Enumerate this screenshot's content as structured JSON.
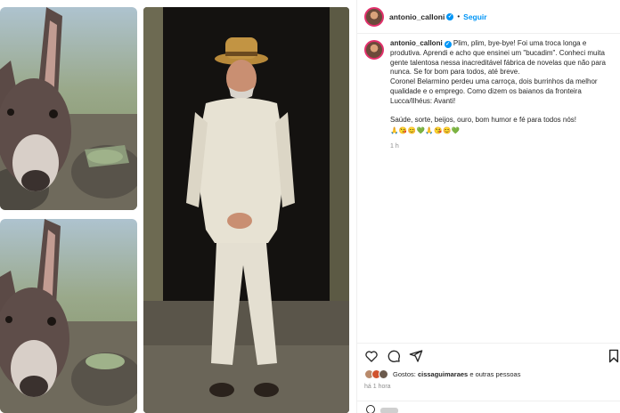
{
  "post": {
    "username": "antonio_calloni",
    "verified_icon": "verified-badge-icon",
    "separator": "•",
    "follow_label": "Seguir",
    "caption_username": "antonio_calloni",
    "caption_text": "Plim, plim, bye-bye! Foi uma troca longa e produtiva. Aprendi e acho que ensinei um \"bucadim\". Conheci muita gente talentosa nessa inacreditável fábrica de novelas que não para nunca. Se for bom para todos, até breve.\nCoronel Belarmino perdeu uma carroça, dois burrinhos da melhor qualidade e o emprego. Como dizem os baianos da fronteira Lucca/Ilhéus: Avanti!\n\nSaúde, sorte, beijos, ouro, bom humor e fé para todos nós!",
    "caption_emojis": "🙏😘😊💚🙏😘😊💚",
    "caption_time": "1 h",
    "likes_prefix": "Gostos:",
    "likes_user": "cissaguimaraes",
    "likes_suffix": "e outras pessoas",
    "posted_time": "há 1 hora"
  },
  "icons": {
    "like": "heart-icon",
    "comment": "comment-icon",
    "share": "share-icon",
    "save": "bookmark-icon",
    "emoji": "emoji-icon"
  },
  "colors": {
    "accent": "#0095f6",
    "text": "#262626",
    "muted": "#8e8e8e",
    "border": "#efefef"
  }
}
